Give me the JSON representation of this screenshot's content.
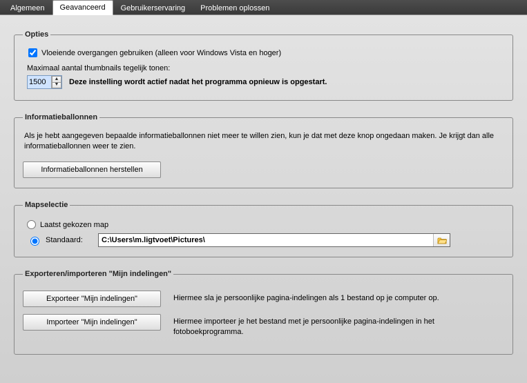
{
  "tabs": {
    "general": "Algemeen",
    "advanced": "Geavanceerd",
    "ux": "Gebruikerservaring",
    "troubleshoot": "Problemen oplossen",
    "active": "advanced"
  },
  "options": {
    "legend": "Opties",
    "smooth_label": "Vloeiende overgangen gebruiken (alleen voor Windows Vista en hoger)",
    "smooth_checked": true,
    "thumb_label": "Maximaal aantal thumbnails tegelijk tonen:",
    "thumb_value": "1500",
    "thumb_note": "Deze instelling wordt actief nadat het programma opnieuw is opgestart."
  },
  "info_balloons": {
    "legend": "Informatieballonnen",
    "text": "Als je hebt aangegeven bepaalde informatieballonnen niet meer te willen zien, kun je dat met deze knop ongedaan maken. Je krijgt dan alle informatieballonnen weer te zien.",
    "restore_btn": "Informatieballonnen herstellen"
  },
  "folder_sel": {
    "legend": "Mapselectie",
    "opt_last": "Laatst gekozen map",
    "opt_default": "Standaard:",
    "selected": "default",
    "path": "C:\\Users\\m.ligtvoet\\Pictures\\"
  },
  "export_import": {
    "legend": "Exporteren/importeren \"Mijn indelingen\"",
    "export_btn": "Exporteer \"Mijn indelingen\"",
    "export_desc": "Hiermee sla je persoonlijke pagina-indelingen als 1 bestand op je computer op.",
    "import_btn": "Importeer \"Mijn indelingen\"",
    "import_desc": "Hiermee importeer je het bestand met je persoonlijke pagina-indelingen in het fotoboekprogramma."
  }
}
